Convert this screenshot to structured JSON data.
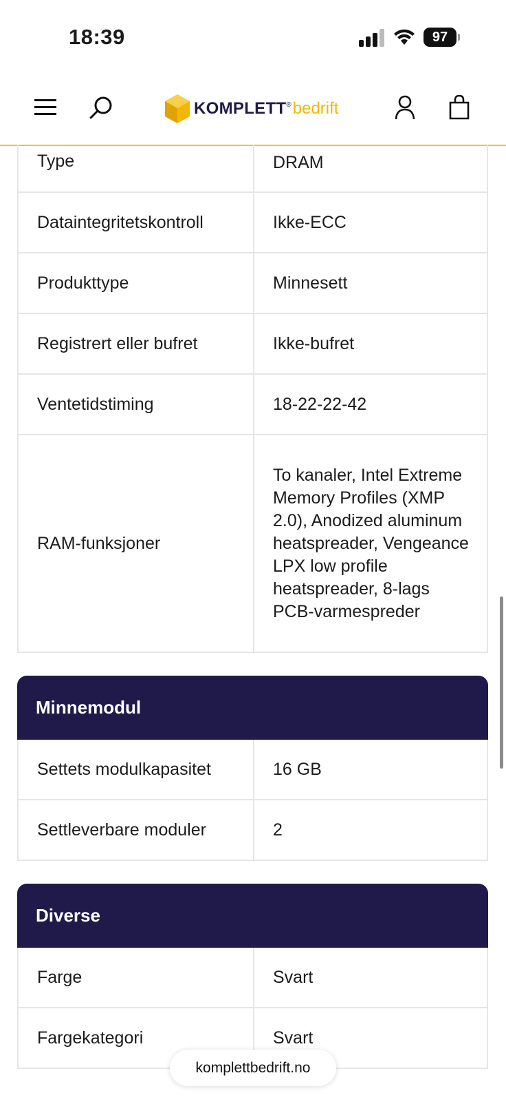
{
  "status_bar": {
    "time": "18:39",
    "battery": "97"
  },
  "header": {
    "logo_brand": "KOMPLETT",
    "logo_reg": "®",
    "logo_sub": "bedrift"
  },
  "spec_rows_top": [
    {
      "label": "Type",
      "value": "DRAM"
    },
    {
      "label": "Dataintegritetskontroll",
      "value": "Ikke-ECC"
    },
    {
      "label": "Produkttype",
      "value": "Minnesett"
    },
    {
      "label": "Registrert eller bufret",
      "value": "Ikke-bufret"
    },
    {
      "label": "Ventetidstiming",
      "value": "18-22-22-42"
    },
    {
      "label": "RAM-funksjoner",
      "value": "To kanaler, Intel Extreme Memory Profiles (XMP 2.0), Anodized aluminum heatspreader, Vengeance LPX low profile heatspreader, 8-lags PCB-varmespreder"
    }
  ],
  "sections": [
    {
      "title": "Minnemodul",
      "rows": [
        {
          "label": "Settets modulkapasitet",
          "value": "16 GB"
        },
        {
          "label": "Settleverbare moduler",
          "value": "2"
        }
      ]
    },
    {
      "title": "Diverse",
      "rows": [
        {
          "label": "Farge",
          "value": "Svart"
        },
        {
          "label": "Fargekategori",
          "value": "Svart"
        }
      ]
    }
  ],
  "browser": {
    "url": "komplettbedrift.no"
  },
  "colors": {
    "accent": "#f2c12e",
    "section_bg": "#1f1a4a",
    "logo_yellow": "#f2b705"
  }
}
